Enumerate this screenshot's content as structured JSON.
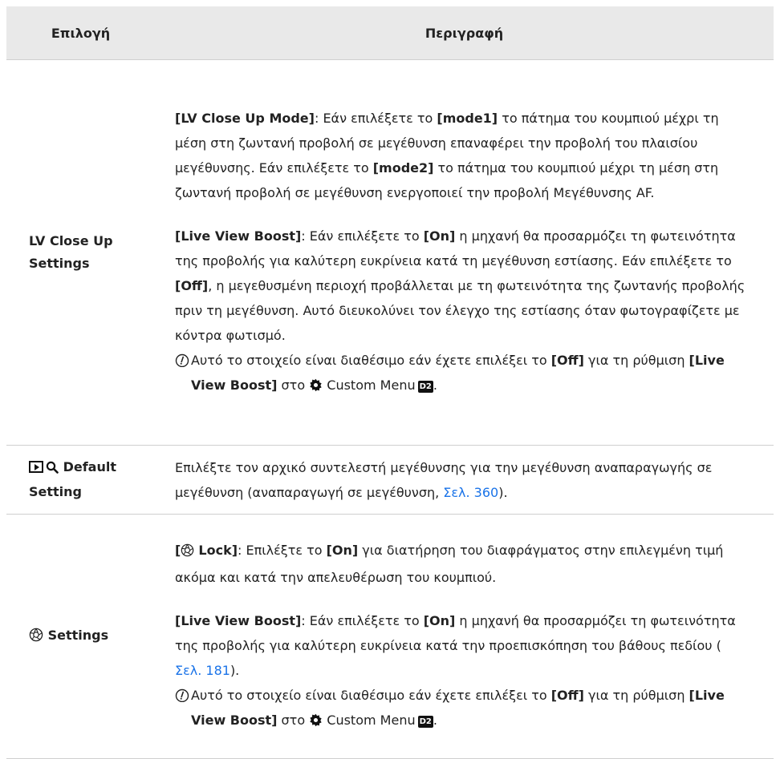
{
  "header": {
    "option": "Επιλογή",
    "description": "Περιγραφή"
  },
  "row1": {
    "option": "LV Close Up Settings",
    "p1_label": "[LV Close Up Mode]",
    "p1_a": ": Εάν επιλέξετε το ",
    "p1_mode1": "[mode1]",
    "p1_b": " το πάτημα του κουμπιού μέχρι τη μέση στη ζωντανή προβολή σε μεγέθυνση επαναφέρει την προβολή του πλαισίου μεγέθυνσης. Εάν επιλέξετε το ",
    "p1_mode2": "[mode2]",
    "p1_c": " το πάτημα του κουμπιού μέχρι τη μέση στη ζωντανή προβολή σε μεγέθυνση ενεργοποιεί την προβολή Μεγέθυνσης AF.",
    "p2_label": "[Live View Boost]",
    "p2_a": ": Εάν επιλέξετε το ",
    "p2_on": "[On]",
    "p2_b": " η μηχανή θα προσαρμόζει τη φωτεινότητα της προβολής για καλύτερη ευκρίνεια κατά τη μεγέθυνση εστίασης. Εάν επιλέξετε το ",
    "p2_off": "[Off]",
    "p2_c": ", η μεγεθυσμένη περιοχή προβάλλεται με τη φωτεινότητα της ζωντανής προβολής πριν τη μεγέθυνση. Αυτό διευκολύνει τον έλεγχο της εστίασης όταν φωτογραφίζετε με κόντρα φωτισμό.",
    "note_a": "Αυτό το στοιχείο είναι διαθέσιμο εάν έχετε επιλέξει το ",
    "note_off": "[Off]",
    "note_b": " για τη ρύθμιση ",
    "note_lvb": "[Live View Boost]",
    "note_c": " στο ",
    "note_menu": "Custom Menu",
    "note_tab": "D2"
  },
  "row2": {
    "option_suffix": "Default Setting",
    "desc": "Επιλέξτε τον αρχικό συντελεστή μεγέθυνσης για την μεγέθυνση αναπαραγωγής σε μεγέθυνση (αναπαραγωγή σε μεγέθυνση, ",
    "link": "Σελ. 360",
    "desc_end": ")."
  },
  "row3": {
    "option_suffix": "Settings",
    "p1_open": "[",
    "p1_lock": "Lock]",
    "p1_a": ": Επιλέξτε το ",
    "p1_on": "[On]",
    "p1_b": " για διατήρηση του διαφράγματος στην επιλεγμένη τιμή ακόμα και κατά την απελευθέρωση του κουμπιού.",
    "p2_label": "[Live View Boost]",
    "p2_a": ": Εάν επιλέξετε το ",
    "p2_on": "[On]",
    "p2_b": " η μηχανή θα προσαρμόζει τη φωτεινότητα της προβολής για καλύτερη ευκρίνεια κατά την προεπισκόπηση του βάθους πεδίου ( ",
    "p2_link": "Σελ. 181",
    "p2_end": ").",
    "note_a": "Αυτό το στοιχείο είναι διαθέσιμο εάν έχετε επιλέξει το ",
    "note_off": "[Off]",
    "note_b": " για τη ρύθμιση ",
    "note_lvb": "[Live View Boost]",
    "note_c": " στο ",
    "note_menu": "Custom Menu",
    "note_tab": "D2"
  },
  "colors": {
    "header_bg": "#e9e9e9",
    "link": "#1a73e8",
    "border": "#cfcfcf"
  },
  "icons": [
    "playback-icon",
    "zoom-icon",
    "aperture-icon",
    "gear-icon",
    "caution-icon"
  ]
}
